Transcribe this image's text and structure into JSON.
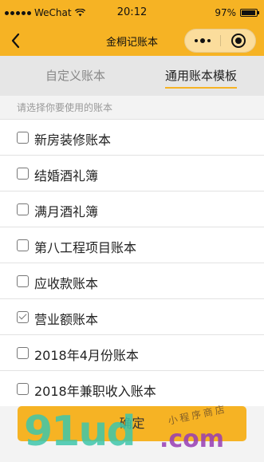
{
  "status": {
    "carrier": "WeChat",
    "time": "20:12",
    "battery": "97%",
    "battery_level": 0.97
  },
  "nav": {
    "title": "金桐记账本"
  },
  "tabs": [
    {
      "label": "自定义账本",
      "active": false
    },
    {
      "label": "通用账本模板",
      "active": true
    }
  ],
  "hint": "请选择你要使用的账本",
  "books": [
    {
      "label": "新房装修账本",
      "checked": false
    },
    {
      "label": "结婚酒礼簿",
      "checked": false
    },
    {
      "label": "满月酒礼簿",
      "checked": false
    },
    {
      "label": "第八工程项目账本",
      "checked": false
    },
    {
      "label": "应收款账本",
      "checked": false
    },
    {
      "label": "营业额账本",
      "checked": true
    },
    {
      "label": "2018年4月份账本",
      "checked": false
    },
    {
      "label": "2018年兼职收入账本",
      "checked": false
    }
  ],
  "confirm_label": "确定",
  "watermark": {
    "main": "91ud",
    "suffix": ".com",
    "slogan": "小程序商店"
  },
  "colors": {
    "accent": "#f6b324"
  }
}
